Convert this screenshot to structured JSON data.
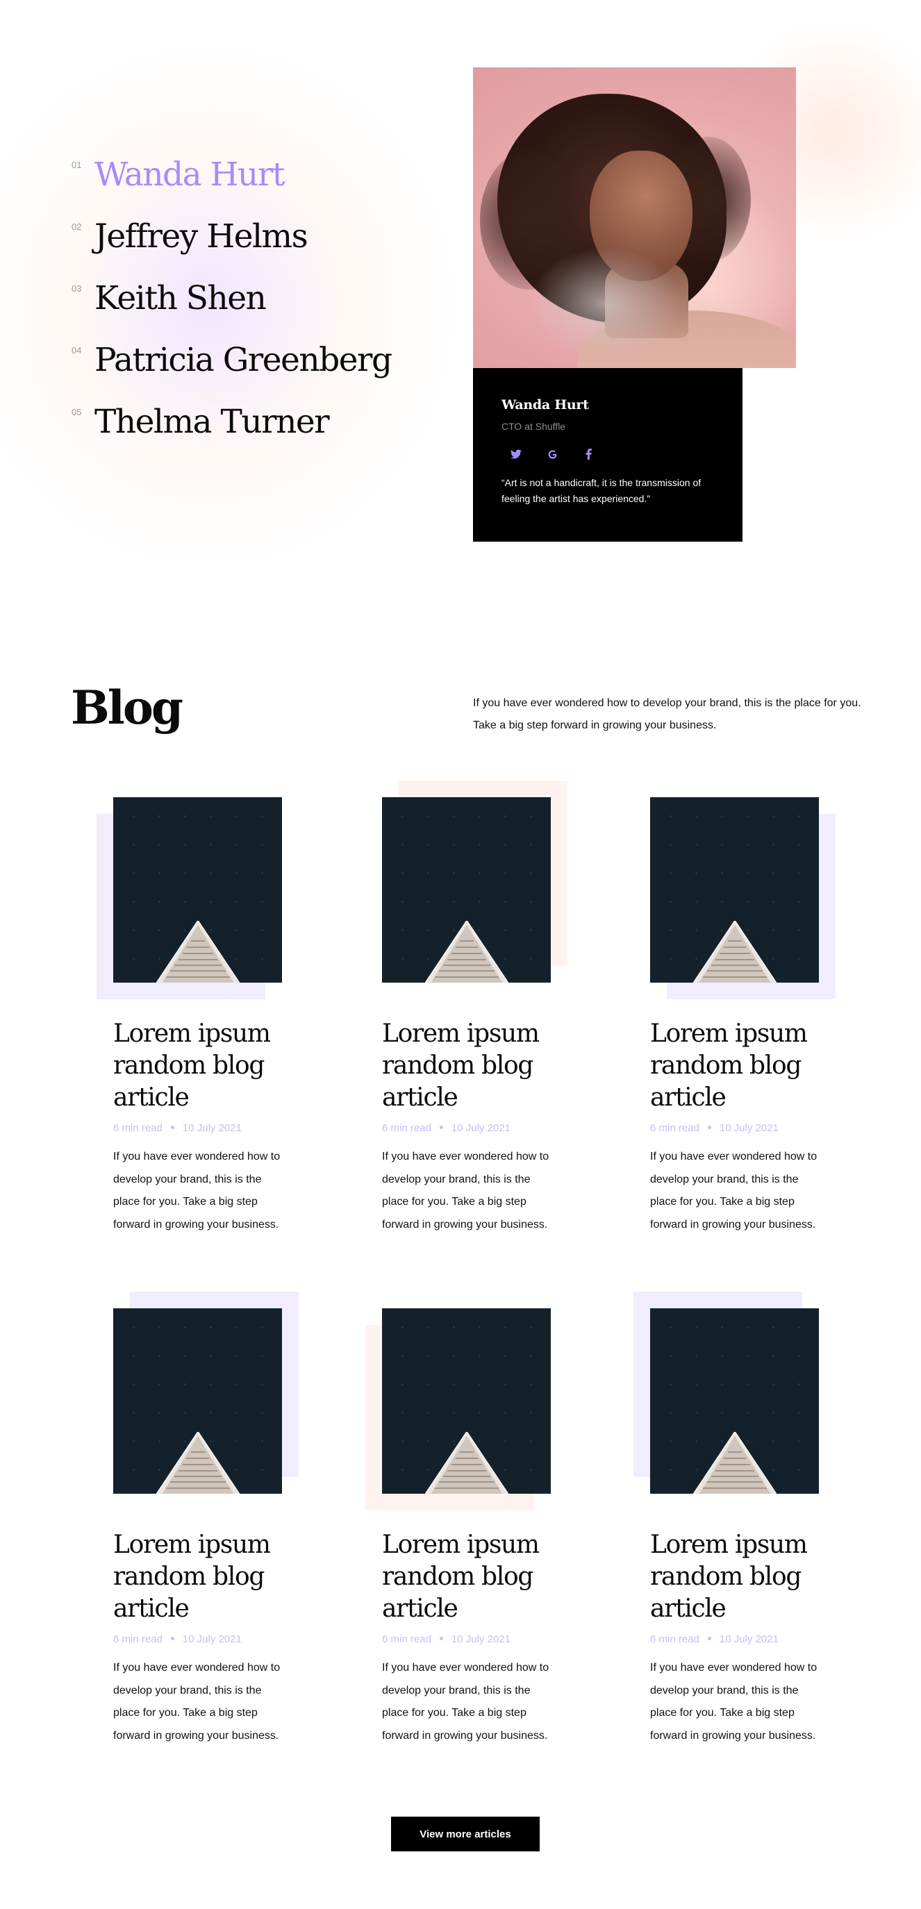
{
  "team": {
    "members": [
      {
        "num": "01",
        "name": "Wanda Hurt"
      },
      {
        "num": "02",
        "name": "Jeffrey Helms"
      },
      {
        "num": "03",
        "name": "Keith Shen"
      },
      {
        "num": "04",
        "name": "Patricia Greenberg"
      },
      {
        "num": "05",
        "name": "Thelma Turner"
      }
    ],
    "active_index": 0,
    "accent_color": "#a78bfa",
    "card": {
      "name": "Wanda Hurt",
      "role": "CTO at Shuffle",
      "social_icons": [
        "twitter-icon",
        "google-icon",
        "facebook-icon"
      ],
      "quote": "“Art is not a handicraft, it is the transmission of feeling the artist has experienced.”"
    }
  },
  "blog": {
    "title": "Blog",
    "intro": "If you have ever wondered how to develop your brand, this is the place for you. Take a big step forward in growing your business.",
    "posts": [
      {
        "title": "Lorem ipsum random blog article",
        "read_time": "6 min read",
        "date": "10 July 2021",
        "excerpt": "If you have ever wondered how to develop your brand, this is the place for you. Take a big step forward in growing your business."
      },
      {
        "title": "Lorem ipsum random blog article",
        "read_time": "6 min read",
        "date": "10 July 2021",
        "excerpt": "If you have ever wondered how to develop your brand, this is the place for you. Take a big step forward in growing your business."
      },
      {
        "title": "Lorem ipsum random blog article",
        "read_time": "6 min read",
        "date": "10 July 2021",
        "excerpt": "If you have ever wondered how to develop your brand, this is the place for you. Take a big step forward in growing your business."
      },
      {
        "title": "Lorem ipsum random blog article",
        "read_time": "6 min read",
        "date": "10 July 2021",
        "excerpt": "If you have ever wondered how to develop your brand, this is the place for you. Take a big step forward in growing your business."
      },
      {
        "title": "Lorem ipsum random blog article",
        "read_time": "6 min read",
        "date": "10 July 2021",
        "excerpt": "If you have ever wondered how to develop your brand, this is the place for you. Take a big step forward in growing your business."
      },
      {
        "title": "Lorem ipsum random blog article",
        "read_time": "6 min read",
        "date": "10 July 2021",
        "excerpt": "If you have ever wondered how to develop your brand, this is the place for you. Take a big step forward in growing your business."
      }
    ],
    "more_button": "View more articles",
    "colors": {
      "lavender": "#f1edfe",
      "peach": "#fff3ef",
      "meta": "#c9bdf3"
    }
  }
}
